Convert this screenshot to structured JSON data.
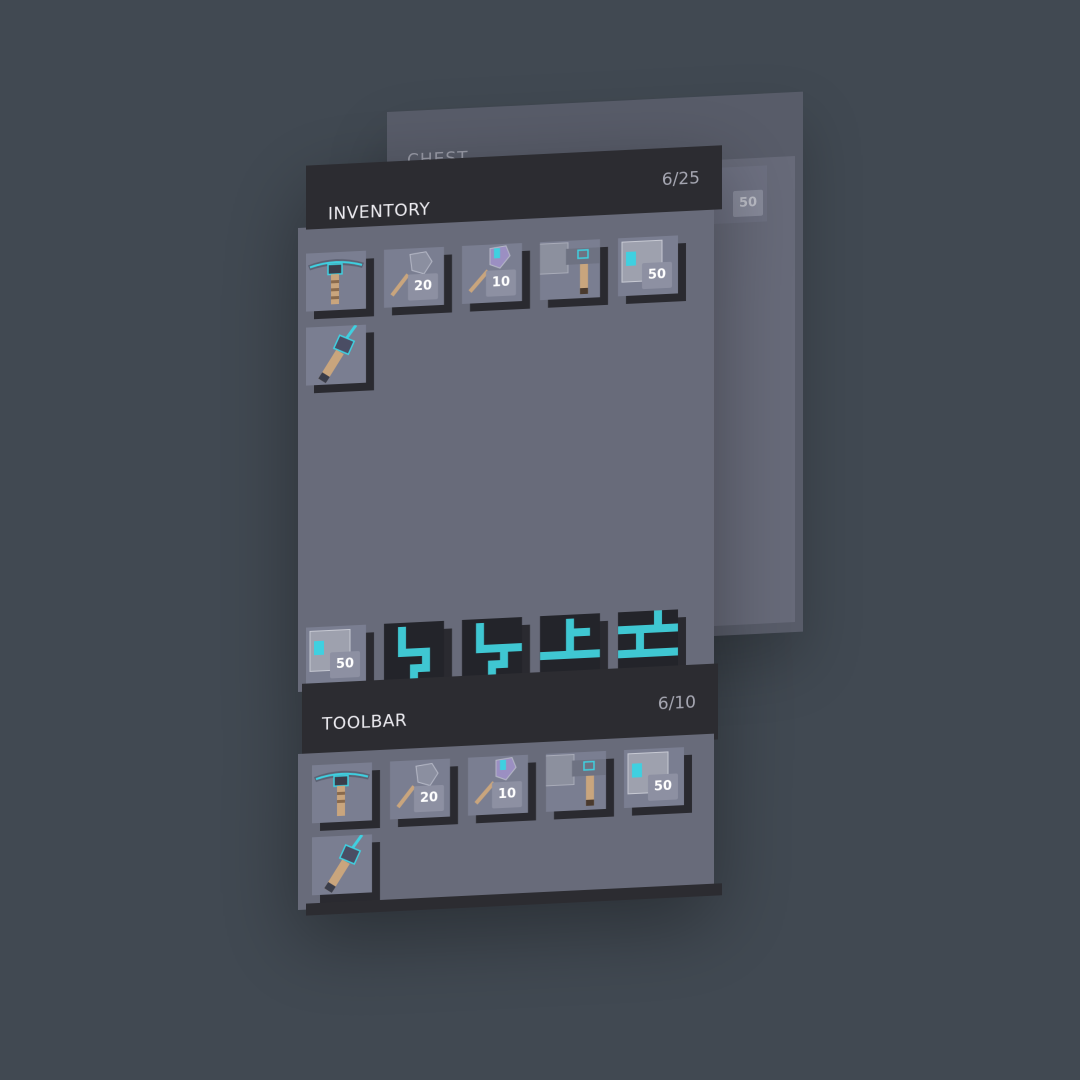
{
  "chest": {
    "title": "CHEST",
    "visible_slot_count": "50"
  },
  "inventory": {
    "title": "INVENTORY",
    "count": "6/25",
    "slots": [
      {
        "icon": "pickaxe-icon",
        "count": ""
      },
      {
        "icon": "stone-shard-icon",
        "count": "20"
      },
      {
        "icon": "crystal-shard-icon",
        "count": "10"
      },
      {
        "icon": "hammer-icon",
        "count": ""
      },
      {
        "icon": "metal-block-icon",
        "count": "50"
      },
      {
        "icon": "drill-tool-icon",
        "count": ""
      }
    ],
    "bottom_row": [
      {
        "icon": "metal-block-icon",
        "count": "50"
      },
      {
        "icon": "wall-piece-a-icon",
        "count": ""
      },
      {
        "icon": "wall-piece-b-icon",
        "count": ""
      },
      {
        "icon": "wall-piece-c-icon",
        "count": ""
      },
      {
        "icon": "wall-piece-d-icon",
        "count": ""
      }
    ]
  },
  "toolbar": {
    "title": "TOOLBAR",
    "count": "6/10",
    "slots": [
      {
        "icon": "pickaxe-icon",
        "count": ""
      },
      {
        "icon": "stone-shard-icon",
        "count": "20"
      },
      {
        "icon": "crystal-shard-icon",
        "count": "10"
      },
      {
        "icon": "hammer-icon",
        "count": ""
      },
      {
        "icon": "metal-block-icon",
        "count": "50"
      },
      {
        "icon": "drill-tool-icon",
        "count": ""
      }
    ]
  },
  "colors": {
    "background": "#414952",
    "panel": "#686b7a",
    "header": "#2c2c31",
    "accent": "#3fd0e0"
  }
}
